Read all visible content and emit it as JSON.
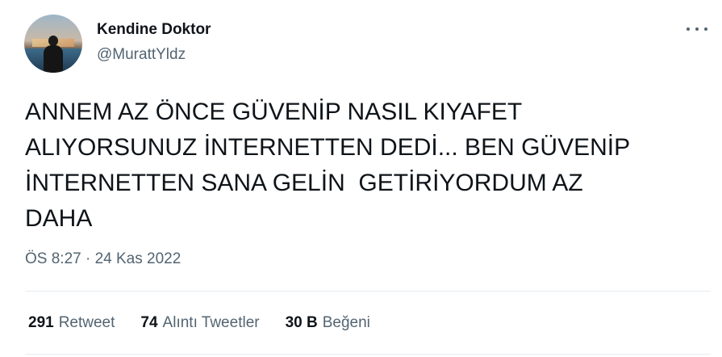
{
  "author": {
    "display_name": "Kendine Doktor",
    "handle": "@MurattYldz"
  },
  "tweet": {
    "text": "ANNEM AZ ÖNCE GÜVENİP NASIL KIYAFET\nALIYORSUNUZ İNTERNETTEN DEDİ... BEN GÜVENİP\nİNTERNETTEN SANA GELİN  GETİRİYORDUM AZ\nDAHA",
    "timestamp": "ÖS 8:27 · 24 Kas 2022"
  },
  "stats": {
    "retweets": {
      "count": "291",
      "label": "Retweet"
    },
    "quotes": {
      "count": "74",
      "label": "Alıntı Tweetler"
    },
    "likes": {
      "count": "30 B",
      "label": "Beğeni"
    }
  },
  "icons": {
    "more": "more-options-icon"
  }
}
